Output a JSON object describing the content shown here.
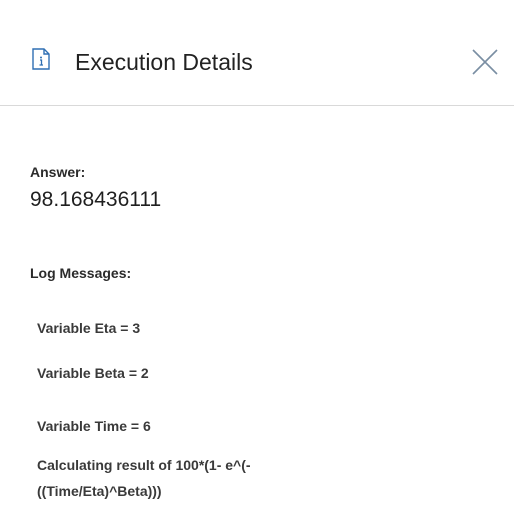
{
  "window": {
    "title": "Execution Details",
    "icon": "document-info-icon",
    "close_icon": "close-icon"
  },
  "result": {
    "answer_label": "Answer:",
    "answer_value": "98.168436111",
    "log_label": "Log Messages:",
    "log_messages": [
      "Variable Eta = 3",
      "Variable Beta = 2",
      "Variable Time = 6",
      "Calculating result of 100*(1- e^(-((Time/Eta)^Beta)))"
    ]
  },
  "colors": {
    "icon_blue": "#2f6fb3",
    "divider": "#d9d9d9",
    "close_gray": "#7a8ea3"
  }
}
